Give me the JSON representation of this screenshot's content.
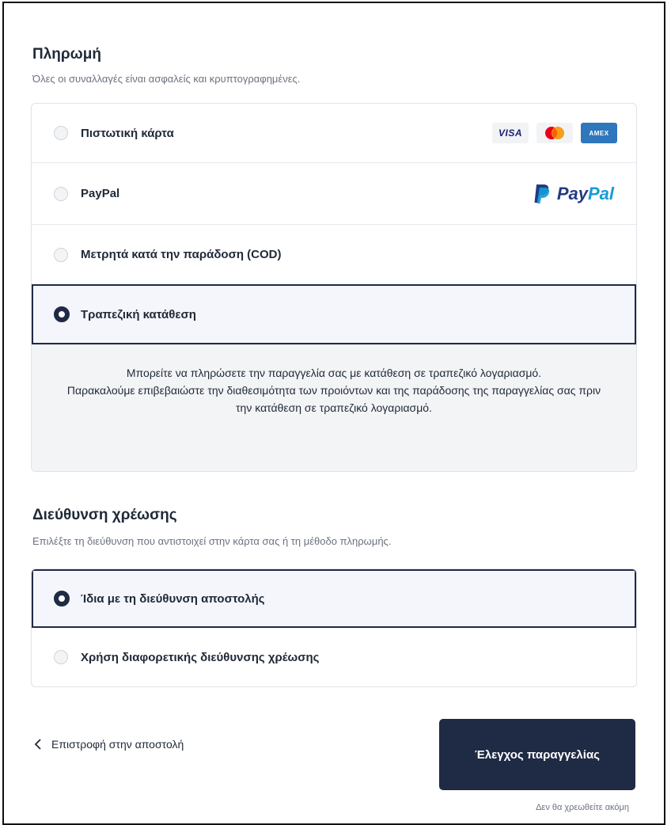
{
  "payment": {
    "title": "Πληρωμή",
    "subtitle": "Όλες οι συναλλαγές είναι ασφαλείς και κρυπτογραφημένες.",
    "options": [
      {
        "label": "Πιστωτική κάρτα",
        "selected": false
      },
      {
        "label": "PayPal",
        "selected": false
      },
      {
        "label": "Μετρητά κατά την παράδοση (COD)",
        "selected": false
      },
      {
        "label": "Τραπεζική κατάθεση",
        "selected": true
      }
    ],
    "card_logos": {
      "visa": "VISA",
      "amex": "AMEX"
    },
    "paypal_logo": {
      "pay": "Pay",
      "pal": "Pal"
    },
    "bank_info": {
      "line1": "Μπορείτε να πληρώσετε την παραγγελία σας με κατάθεση σε τραπεζικό λογαριασμό.",
      "line2": "Παρακαλούμε επιβεβαιώστε την διαθεσιμότητα των προιόντων και της παράδοσης της παραγγελίας σας πριν την κατάθεση σε τραπεζικό λογαριασμό."
    }
  },
  "billing": {
    "title": "Διεύθυνση χρέωσης",
    "subtitle": "Επιλέξτε τη διεύθυνση που αντιστοιχεί στην κάρτα σας ή τη μέθοδο πληρωμής.",
    "options": [
      {
        "label": "Ίδια με τη διεύθυνση αποστολής",
        "selected": true
      },
      {
        "label": "Χρήση διαφορετικής διεύθυνσης χρέωσης",
        "selected": false
      }
    ]
  },
  "footer": {
    "back_label": "Επιστροφή στην αποστολή",
    "submit_label": "Έλεγχος παραγγελίας",
    "hint": "Δεν θα χρεωθείτε ακόμη"
  },
  "colors": {
    "primary": "#1f2a44",
    "paypal_dark": "#253b80",
    "paypal_light": "#179bd7",
    "amex": "#2e77bc"
  }
}
